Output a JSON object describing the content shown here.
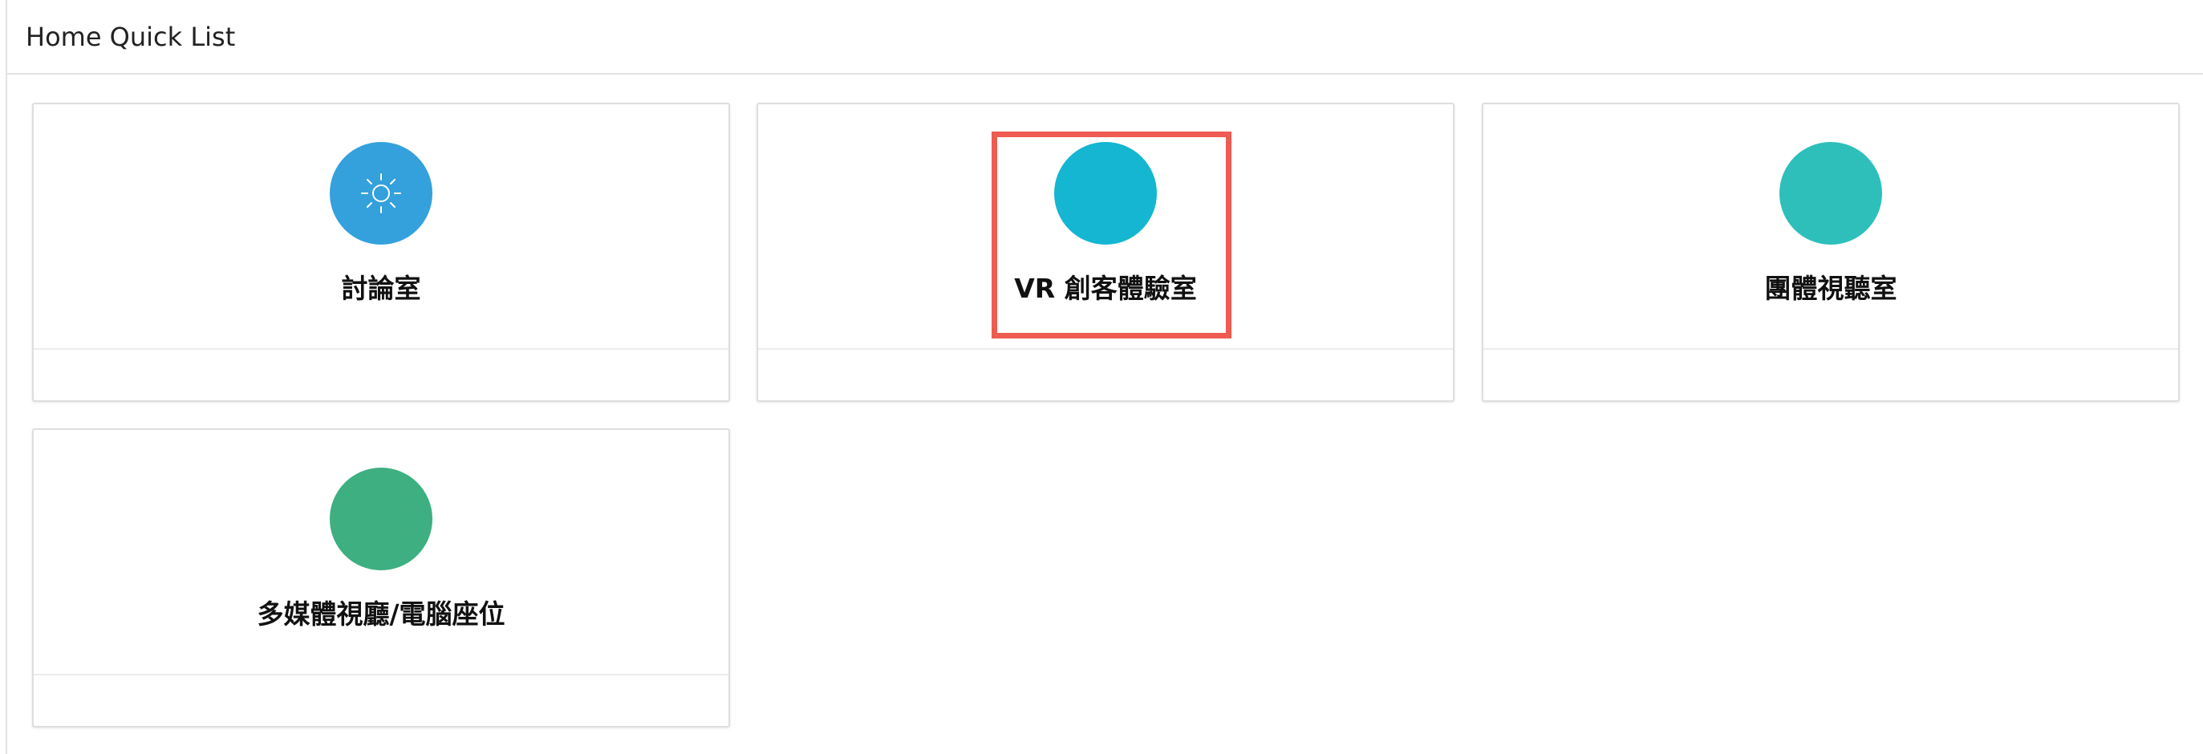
{
  "panel": {
    "title": "Home Quick List"
  },
  "cards": [
    {
      "label": "討論室",
      "icon": "sun-icon",
      "color": "#34a0dc"
    },
    {
      "label": "VR 創客體驗室",
      "icon": "",
      "color": "#14b6d1"
    },
    {
      "label": "團體視聽室",
      "icon": "",
      "color": "#2ebfbb"
    },
    {
      "label": "多媒體視廳/電腦座位",
      "icon": "",
      "color": "#3daf80"
    }
  ],
  "colors": {
    "highlight": "#ee5b50",
    "border": "#dedede"
  }
}
